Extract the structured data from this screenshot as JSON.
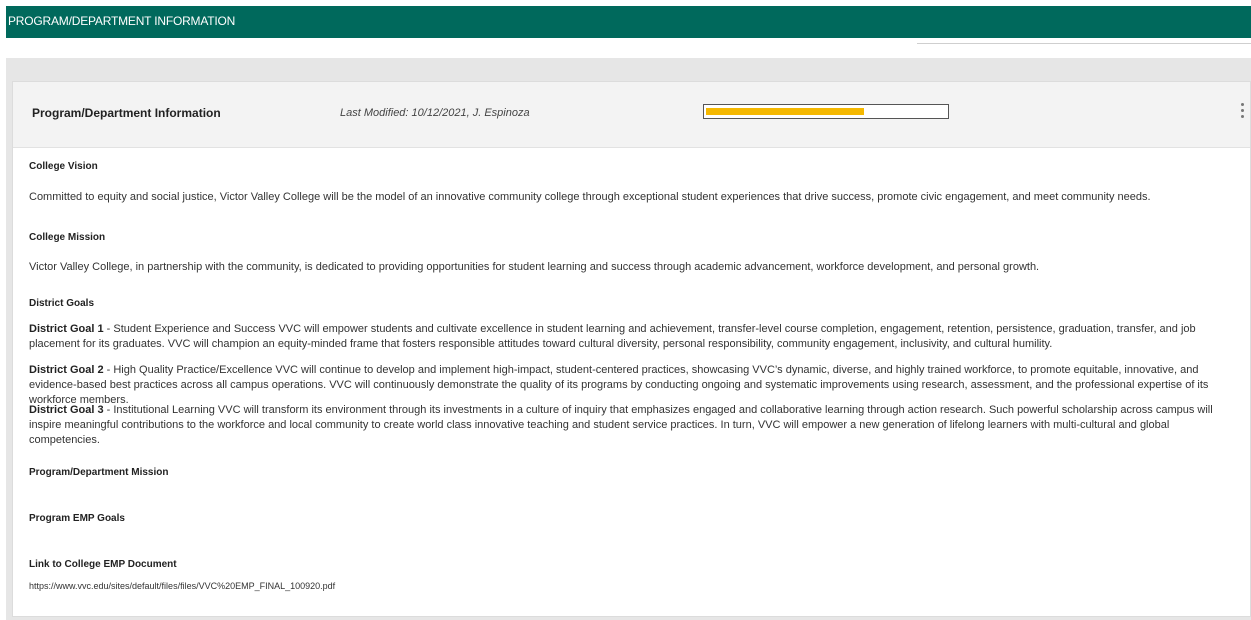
{
  "topbar": {
    "title": "PROGRAM/DEPARTMENT INFORMATION"
  },
  "card": {
    "title": "Program/Department Information",
    "last_modified": "Last Modified: 10/12/2021, J. Espinoza",
    "progress_fraction": 0.66,
    "progress_color": "#f5b800"
  },
  "sections": {
    "vision_label": "College Vision",
    "vision_text": "Committed to equity and social justice, Victor Valley College will be the model of an innovative community college through exceptional student experiences that drive success, promote civic engagement, and meet community needs.",
    "mission_label": "College Mission",
    "mission_text": "Victor Valley College, in partnership with the community, is dedicated to providing opportunities for student learning and success through academic advancement, workforce development, and personal growth.",
    "district_goals_label": "District Goals",
    "goals": [
      {
        "title": "District Goal 1",
        "text": " - Student Experience and Success VVC will empower students and cultivate excellence in student learning and achievement, transfer-level course completion, engagement, retention, persistence, graduation, transfer, and job placement for its graduates. VVC will champion an equity-minded frame that fosters responsible attitudes toward cultural diversity, personal responsibility, community engagement, inclusivity, and cultural humility."
      },
      {
        "title": "District Goal 2",
        "text": " - High Quality Practice/Excellence VVC will continue to develop and implement high-impact, student-centered practices, showcasing VVC’s dynamic, diverse, and highly trained workforce, to promote equitable, innovative, and evidence-based best practices across all campus operations. VVC will continuously demonstrate the quality of its programs by conducting ongoing and systematic improvements using research, assessment, and the professional expertise of its workforce members."
      },
      {
        "title": "District Goal 3",
        "text": " - Institutional Learning VVC will transform its environment through its investments in a culture of inquiry that emphasizes engaged and collaborative learning through action research. Such powerful scholarship across campus will inspire meaningful contributions to the workforce and local community to create world class innovative teaching and student service practices. In turn, VVC will empower a new generation of lifelong learners with multi-cultural and global competencies."
      }
    ],
    "program_mission_label": "Program/Department Mission",
    "program_emp_label": "Program EMP Goals",
    "emp_link_label": "Link to College EMP Document",
    "emp_link_url": "https://www.vvc.edu/sites/default/files/files/VVC%20EMP_FINAL_100920.pdf"
  }
}
